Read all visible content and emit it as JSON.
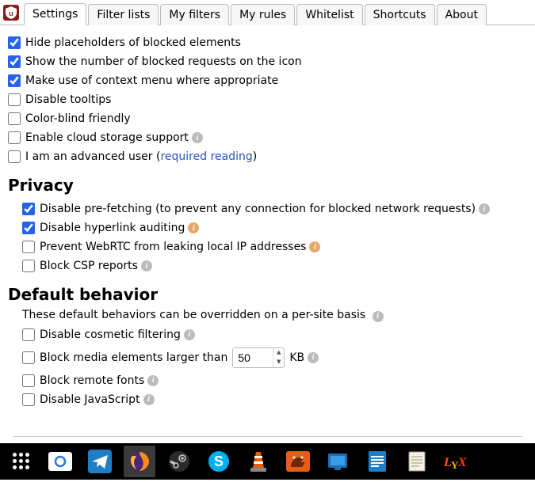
{
  "tabs": {
    "settings": "Settings",
    "filter_lists": "Filter lists",
    "my_filters": "My filters",
    "my_rules": "My rules",
    "whitelist": "Whitelist",
    "shortcuts": "Shortcuts",
    "about": "About"
  },
  "general": {
    "hide_placeholders": "Hide placeholders of blocked elements",
    "show_count": "Show the number of blocked requests on the icon",
    "context_menu": "Make use of context menu where appropriate",
    "disable_tooltips": "Disable tooltips",
    "color_blind": "Color-blind friendly",
    "cloud_storage": "Enable cloud storage support",
    "advanced_user_pre": "I am an advanced user (",
    "advanced_user_link": "required reading",
    "advanced_user_post": ")"
  },
  "privacy": {
    "title": "Privacy",
    "prefetch": "Disable pre-fetching (to prevent any connection for blocked network requests)",
    "hyperlink_audit": "Disable hyperlink auditing",
    "webrtc": "Prevent WebRTC from leaking local IP addresses",
    "csp": "Block CSP reports"
  },
  "default_behavior": {
    "title": "Default behavior",
    "desc": "These default behaviors can be overridden on a per-site basis",
    "cosmetic": "Disable cosmetic filtering",
    "media_larger": "Block media elements larger than",
    "media_value": "50",
    "media_unit": "KB",
    "remote_fonts": "Block remote fonts",
    "disable_js": "Disable JavaScript"
  },
  "checked": {
    "hide_placeholders": true,
    "show_count": true,
    "context_menu": true,
    "prefetch": true,
    "hyperlink_audit": true
  },
  "taskbar": [
    "apps-launcher",
    "screenshot",
    "telegram",
    "firefox",
    "steam",
    "skype",
    "vlc",
    "foxit",
    "virtualbox",
    "libreoffice",
    "notes",
    "lyx"
  ]
}
